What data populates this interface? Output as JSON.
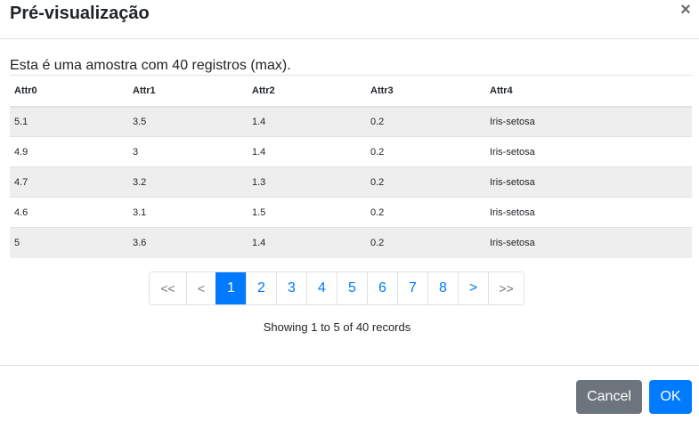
{
  "modal": {
    "title": "Pré-visualização",
    "close_glyph": "×"
  },
  "description": "Esta é uma amostra com 40 registros (max).",
  "table": {
    "headers": [
      "Attr0",
      "Attr1",
      "Attr2",
      "Attr3",
      "Attr4"
    ],
    "rows": [
      [
        "5.1",
        "3.5",
        "1.4",
        "0.2",
        "Iris-setosa"
      ],
      [
        "4.9",
        "3",
        "1.4",
        "0.2",
        "Iris-setosa"
      ],
      [
        "4.7",
        "3.2",
        "1.3",
        "0.2",
        "Iris-setosa"
      ],
      [
        "4.6",
        "3.1",
        "1.5",
        "0.2",
        "Iris-setosa"
      ],
      [
        "5",
        "3.6",
        "1.4",
        "0.2",
        "Iris-setosa"
      ]
    ]
  },
  "pagination": {
    "first": "<<",
    "prev": "<",
    "pages": [
      "1",
      "2",
      "3",
      "4",
      "5",
      "6",
      "7",
      "8"
    ],
    "active_page": "1",
    "next": ">",
    "last": ">>"
  },
  "records_info": "Showing 1 to 5 of 40 records",
  "footer": {
    "cancel_label": "Cancel",
    "ok_label": "OK"
  },
  "colors": {
    "primary": "#007bff",
    "secondary": "#6c757d",
    "row_stripe": "#eeeeee",
    "border": "#dee2e6"
  }
}
